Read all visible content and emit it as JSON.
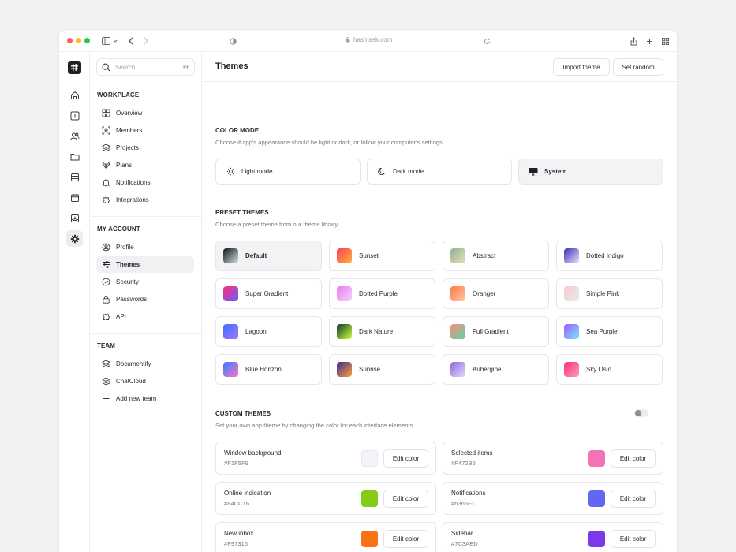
{
  "browser": {
    "url": "hashtask.com",
    "traffic_lights": [
      "#FF5F57",
      "#FEBC2E",
      "#28C840"
    ]
  },
  "rail": {
    "items": [
      {
        "icon": "home-icon"
      },
      {
        "icon": "chart-icon"
      },
      {
        "icon": "users-icon"
      },
      {
        "icon": "folder-icon"
      },
      {
        "icon": "database-icon"
      },
      {
        "icon": "calendar-icon"
      },
      {
        "icon": "inbox-icon"
      },
      {
        "icon": "settings-icon",
        "active": true
      }
    ]
  },
  "search": {
    "placeholder": "Search",
    "shortcut": "⌘F"
  },
  "sidebar": {
    "workplace_title": "WORKPLACE",
    "workplace": [
      {
        "label": "Overview",
        "icon": "grid-icon"
      },
      {
        "label": "Members",
        "icon": "members-icon"
      },
      {
        "label": "Projects",
        "icon": "layers-icon"
      },
      {
        "label": "Plans",
        "icon": "diamond-icon"
      },
      {
        "label": "Notifications",
        "icon": "bell-icon"
      },
      {
        "label": "Integrations",
        "icon": "puzzle-icon"
      }
    ],
    "account_title": "MY ACCOUNT",
    "account": [
      {
        "label": "Profile",
        "icon": "user-circle-icon"
      },
      {
        "label": "Themes",
        "icon": "sliders-icon",
        "active": true
      },
      {
        "label": "Security",
        "icon": "check-circle-icon"
      },
      {
        "label": "Passwords",
        "icon": "lock-icon"
      },
      {
        "label": "API",
        "icon": "puzzle-icon"
      }
    ],
    "team_title": "TEAM",
    "team": [
      {
        "label": "Documentify",
        "icon": "layers-icon"
      },
      {
        "label": "ChatCloud",
        "icon": "layers-icon"
      },
      {
        "label": "Add new team",
        "icon": "plus-icon"
      }
    ]
  },
  "header": {
    "title": "Themes",
    "import_label": "Import theme",
    "random_label": "Set random"
  },
  "color_mode": {
    "title": "COLOR MODE",
    "subtitle": "Choose if app's appearance should be light or dark, or follow your computer's settings.",
    "options": [
      {
        "label": "Light mode",
        "icon": "sun-icon"
      },
      {
        "label": "Dark mode",
        "icon": "moon-icon"
      },
      {
        "label": "System",
        "icon": "monitor-icon",
        "selected": true
      }
    ]
  },
  "preset_themes": {
    "title": "PRESET THEMES",
    "subtitle": "Choose a preset theme from our theme library.",
    "items": [
      {
        "label": "Default",
        "selected": true,
        "colors": [
          "#111318",
          "#CFE3E4"
        ]
      },
      {
        "label": "Sunset",
        "colors": [
          "#FF3D55",
          "#FFB23F"
        ]
      },
      {
        "label": "Abstract",
        "colors": [
          "#8DB58E",
          "#E7DCC0"
        ]
      },
      {
        "label": "Dotted Indigo",
        "colors": [
          "#3C2FB8",
          "#E8E4FF"
        ]
      },
      {
        "label": "Super Gradient",
        "colors": [
          "#FF2F7A",
          "#6A5CFF"
        ]
      },
      {
        "label": "Dotted Purple",
        "colors": [
          "#E77AF0",
          "#F6D3FB"
        ]
      },
      {
        "label": "Oranger",
        "colors": [
          "#FF7A45",
          "#FFC7A8"
        ]
      },
      {
        "label": "Simple Pink",
        "colors": [
          "#F9C8CF",
          "#E6EFE6"
        ]
      },
      {
        "label": "Lagoon",
        "colors": [
          "#3F6DFF",
          "#9F7AFF"
        ]
      },
      {
        "label": "Dark Nature",
        "colors": [
          "#0A3A2F",
          "#D6FF3A"
        ]
      },
      {
        "label": "Full Gradient",
        "colors": [
          "#FF8A7A",
          "#58D6A8"
        ]
      },
      {
        "label": "Sea Purple",
        "colors": [
          "#A05BFF",
          "#7AE6FF"
        ]
      },
      {
        "label": "Blue Horizon",
        "colors": [
          "#2F7BFF",
          "#FF77C8"
        ]
      },
      {
        "label": "Sunrise",
        "colors": [
          "#3C2C8C",
          "#FFA13A"
        ]
      },
      {
        "label": "Aubergine",
        "colors": [
          "#8E6BD8",
          "#E7D6FF"
        ]
      },
      {
        "label": "Sky Oslo",
        "colors": [
          "#FF2F6E",
          "#FF9DC0"
        ]
      }
    ]
  },
  "custom_themes": {
    "title": "CUSTOM THEMES",
    "subtitle": "Set your own app theme by changing the color for each interface elements.",
    "enabled": false,
    "edit_label": "Edit color",
    "items": [
      {
        "label": "Window background",
        "hex": "#F1F5F9",
        "color": "#F1F5F9"
      },
      {
        "label": "Selected items",
        "hex": "#F472B6",
        "color": "#F472B6"
      },
      {
        "label": "Online indication",
        "hex": "#84CC16",
        "color": "#84CC16"
      },
      {
        "label": "Notifications",
        "hex": "#6366F1",
        "color": "#6366F1"
      },
      {
        "label": "New inbox",
        "hex": "#F97316",
        "color": "#F97316"
      },
      {
        "label": "Sidebar",
        "hex": "#7C3AED",
        "color": "#7C3AED"
      }
    ]
  }
}
